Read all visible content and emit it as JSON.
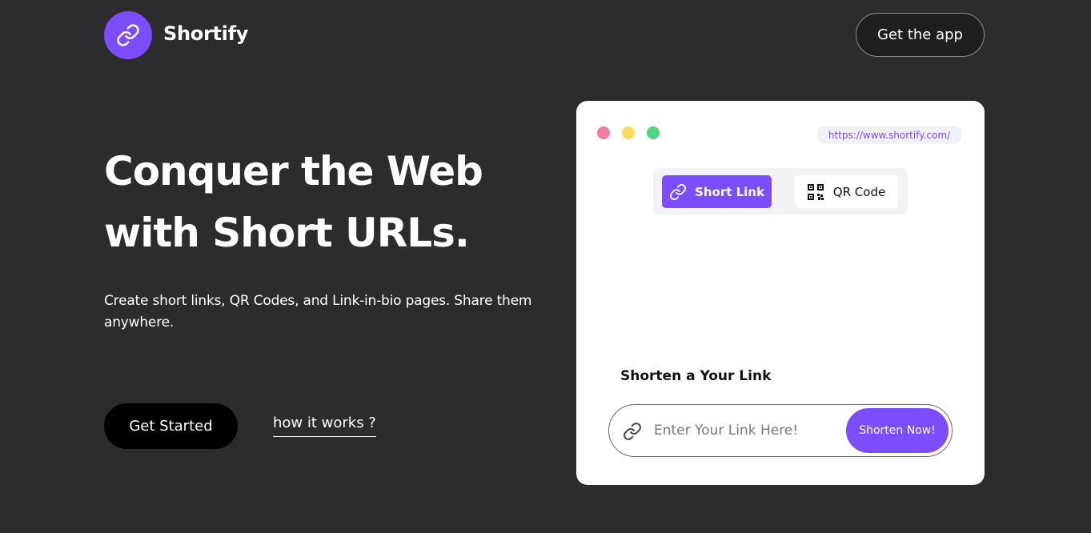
{
  "brand": {
    "name": "Shortify",
    "logo_icon": "link-icon",
    "accent": "#7c4dff"
  },
  "header": {
    "get_app_label": "Get the app"
  },
  "hero": {
    "title_line1": "Conquer the Web",
    "title_line2": "with Short URLs.",
    "description": "Create short links, QR Codes, and Link-in-bio pages. Share them anywhere.",
    "get_started_label": "Get Started",
    "how_it_works_label": "how it works ?"
  },
  "card": {
    "url": "https://www.shortify.com/",
    "window_dots": [
      "#f07ca0",
      "#f8dc5e",
      "#4fd67e"
    ],
    "tabs": [
      {
        "label": "Short Link",
        "icon": "link-icon",
        "active": true
      },
      {
        "label": "QR Code",
        "icon": "qr-code-icon",
        "active": false
      }
    ],
    "shorten_title": "Shorten a Your Link",
    "input_placeholder": "Enter Your Link Here!",
    "shorten_button_label": "Shorten Now!"
  }
}
